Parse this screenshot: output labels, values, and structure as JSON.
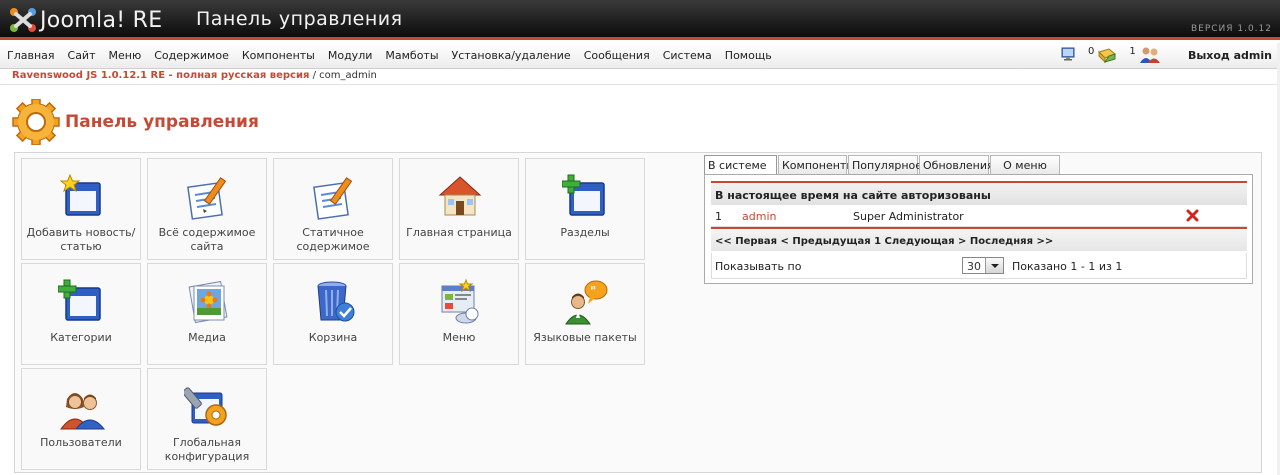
{
  "header": {
    "logo_text": "Joomla! RE",
    "title": "Панель управления",
    "version": "ВЕРСИЯ 1.0.12"
  },
  "menu": {
    "items": [
      "Главная",
      "Сайт",
      "Меню",
      "Содержимое",
      "Компоненты",
      "Модули",
      "Мамботы",
      "Установка/удаление",
      "Сообщения",
      "Система",
      "Помощь"
    ]
  },
  "status": {
    "messages_count": "0",
    "users_count": "1",
    "logout": "Выход admin"
  },
  "breadcrumb": {
    "site": "Ravenswood JS 1.0.12.1 RE - полная русская версия",
    "separator": " / ",
    "current": "com_admin"
  },
  "page_title": "Панель управления",
  "tiles": [
    {
      "label": "Добавить новость/статью",
      "icon": "add-article-icon"
    },
    {
      "label": "Всё содержимое сайта",
      "icon": "all-content-icon"
    },
    {
      "label": "Статичное содержимое",
      "icon": "static-content-icon"
    },
    {
      "label": "Главная страница",
      "icon": "home-icon"
    },
    {
      "label": "Разделы",
      "icon": "sections-icon"
    },
    {
      "label": "Категории",
      "icon": "categories-icon"
    },
    {
      "label": "Медиа",
      "icon": "media-icon"
    },
    {
      "label": "Корзина",
      "icon": "trash-icon"
    },
    {
      "label": "Меню",
      "icon": "menu-manager-icon"
    },
    {
      "label": "Языковые пакеты",
      "icon": "language-icon"
    },
    {
      "label": "Пользователи",
      "icon": "users-icon"
    },
    {
      "label": "Глобальная конфигурация",
      "icon": "config-icon"
    }
  ],
  "tabs": [
    "В системе",
    "Компоненты",
    "Популярное",
    "Обновления",
    "О меню"
  ],
  "online": {
    "heading": "В настоящее время на сайте авторизованы",
    "rows": [
      {
        "num": "1",
        "user": "admin",
        "role": "Super Administrator"
      }
    ],
    "pager": "<< Первая < Предыдущая 1 Следующая > Последняя >>",
    "show_label": "Показывать по",
    "show_value": "30",
    "shown_text": "Показано 1 - 1 из 1"
  },
  "colors": {
    "accent": "#c64934",
    "header_bg": "#1a1a1a"
  }
}
